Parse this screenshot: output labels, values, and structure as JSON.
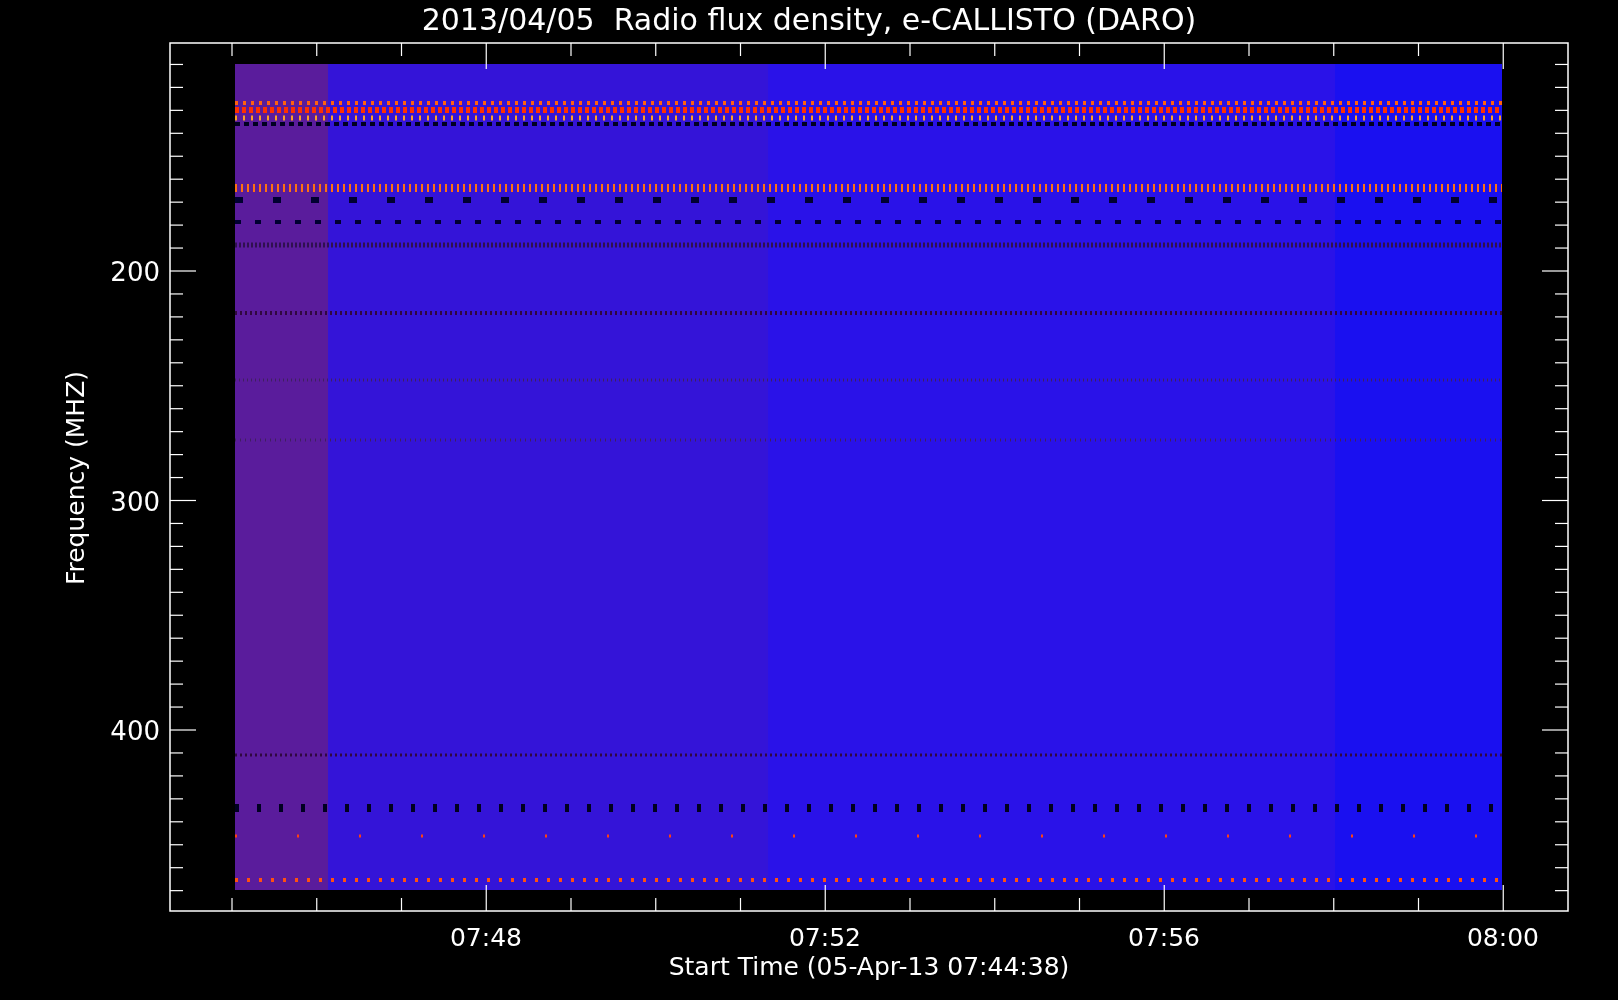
{
  "title": "2013/04/05  Radio flux density, e-CALLISTO (DARO)",
  "y_axis": {
    "label": "Frequency (MHZ)",
    "ticks": [
      "200",
      "300",
      "400"
    ]
  },
  "x_axis": {
    "label": "Start Time (05-Apr-13 07:44:38)",
    "ticks": [
      "07:48",
      "07:52",
      "07:56",
      "08:00"
    ]
  }
}
